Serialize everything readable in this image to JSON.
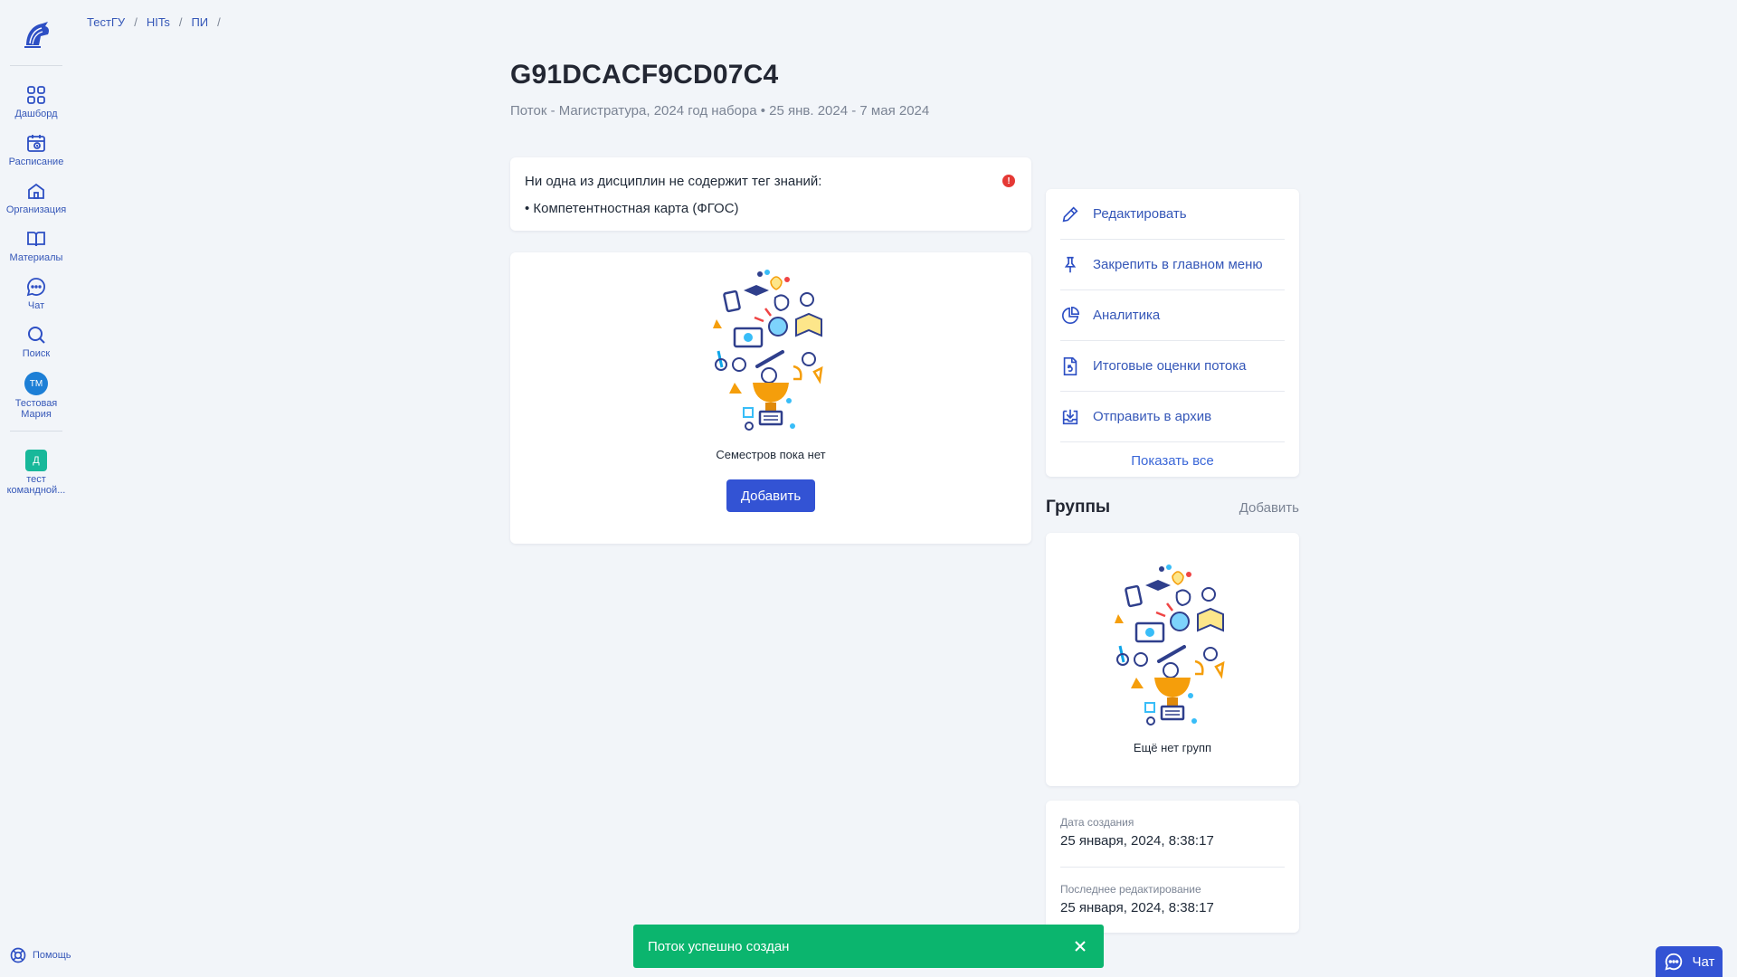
{
  "sidebar": {
    "logo": "spartan-helmet-logo",
    "items": [
      {
        "label": "Дашборд",
        "icon": "dashboard-icon"
      },
      {
        "label": "Расписание",
        "icon": "calendar-icon"
      },
      {
        "label": "Организация",
        "icon": "home-icon"
      },
      {
        "label": "Материалы",
        "icon": "book-icon"
      },
      {
        "label": "Чат",
        "icon": "chat-icon"
      },
      {
        "label": "Поиск",
        "icon": "search-icon"
      }
    ],
    "user": {
      "initials": "ТМ",
      "label": "Тестовая Мария"
    },
    "team": {
      "initial": "Д",
      "label": "тест командной..."
    },
    "help_label": "Помощь"
  },
  "breadcrumb": [
    "ТестГУ",
    "HITs",
    "ПИ"
  ],
  "header": {
    "title": "G91DCACF9CD07C4",
    "subtitle": "Поток - Магистратура, 2024 год набора • 25 янв. 2024 - 7 мая 2024"
  },
  "warning": {
    "text": "Ни одна из дисциплин не содержит тег знаний:",
    "item": "• Компетентностная карта (ФГОС)",
    "icon": "!"
  },
  "semesters": {
    "empty_text": "Семестров пока нет",
    "add_label": "Добавить"
  },
  "actions": {
    "items": [
      {
        "label": "Редактировать",
        "icon": "pencil-icon"
      },
      {
        "label": "Закрепить в главном меню",
        "icon": "pin-icon"
      },
      {
        "label": "Аналитика",
        "icon": "pie-chart-icon"
      },
      {
        "label": "Итоговые оценки потока",
        "icon": "grade-document-icon"
      },
      {
        "label": "Отправить в архив",
        "icon": "archive-icon"
      }
    ],
    "show_all": "Показать все"
  },
  "groups": {
    "title": "Группы",
    "add_label": "Добавить",
    "empty_text": "Ещё нет групп"
  },
  "meta": {
    "created_label": "Дата создания",
    "created_value": "25 января, 2024, 8:38:17",
    "edited_label": "Последнее редактирование",
    "edited_value": "25 января, 2024, 8:38:17"
  },
  "toast": {
    "text": "Поток успешно создан"
  },
  "chat_button": {
    "label": "Чат"
  },
  "colors": {
    "accent": "#3353d4",
    "link": "#3557b8",
    "success": "#0bb56e",
    "error": "#e53935"
  }
}
